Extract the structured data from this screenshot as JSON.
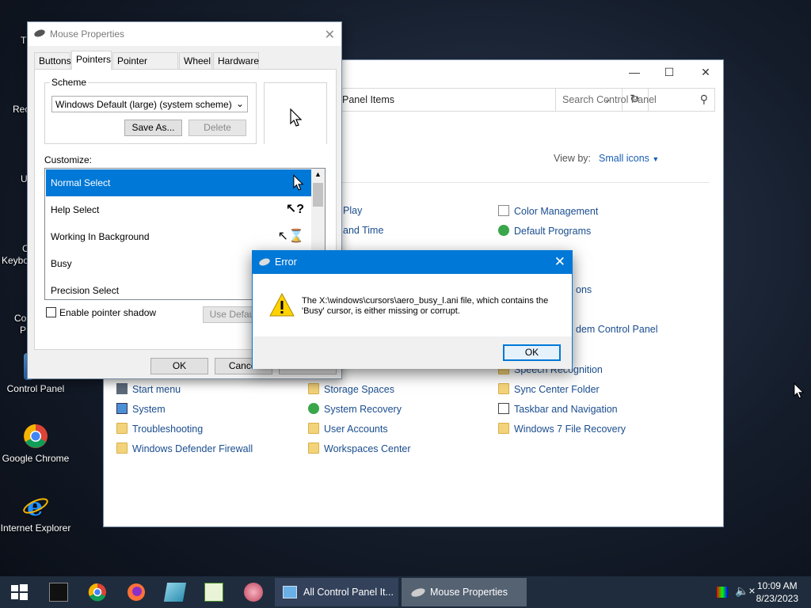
{
  "desktop": {
    "icons": [
      {
        "label": "Control Panel"
      },
      {
        "label": "Google Chrome"
      },
      {
        "label": "Internet Explorer"
      }
    ],
    "partial_labels": [
      "Th",
      "Rec",
      "U",
      "C",
      "Keybo",
      "Co",
      "P"
    ]
  },
  "control_panel": {
    "address": "Panel Items",
    "search_placeholder": "Search Control Panel",
    "view_by_label": "View by:",
    "view_by_value": "Small icons",
    "items": [
      "Play",
      "and Time",
      "ons",
      "Color Management",
      "Default Programs",
      "dem Control Panel",
      "Speech Recognition",
      "Start menu",
      "Storage Spaces",
      "Sync Center Folder",
      "System",
      "System Recovery",
      "Taskbar and Navigation",
      "Troubleshooting",
      "User Accounts",
      "Windows 7 File Recovery",
      "Windows Defender Firewall",
      "Workspaces Center"
    ]
  },
  "mouse_properties": {
    "title": "Mouse Properties",
    "tabs": [
      "Buttons",
      "Pointers",
      "Pointer Options",
      "Wheel",
      "Hardware"
    ],
    "active_tab": "Pointers",
    "scheme_label": "Scheme",
    "scheme_value": "Windows Default (large) (system scheme)",
    "save_as": "Save As...",
    "delete": "Delete",
    "customize_label": "Customize:",
    "cursor_rows": [
      "Normal Select",
      "Help Select",
      "Working In Background",
      "Busy",
      "Precision Select"
    ],
    "enable_shadow": "Enable pointer shadow",
    "use_default": "Use Default",
    "ok": "OK",
    "cancel": "Cancel"
  },
  "error_dialog": {
    "title": "Error",
    "message": "The X:\\windows\\cursors\\aero_busy_l.ani file, which contains the 'Busy' cursor, is either missing or corrupt.",
    "ok": "OK"
  },
  "taskbar": {
    "window_buttons": [
      "All Control Panel It...",
      "Mouse Properties"
    ],
    "time": "10:09 AM",
    "date": "8/23/2023"
  },
  "colors": {
    "accent": "#0078d7",
    "taskbar": "#1f2c3d",
    "link": "#1a4d8f"
  }
}
